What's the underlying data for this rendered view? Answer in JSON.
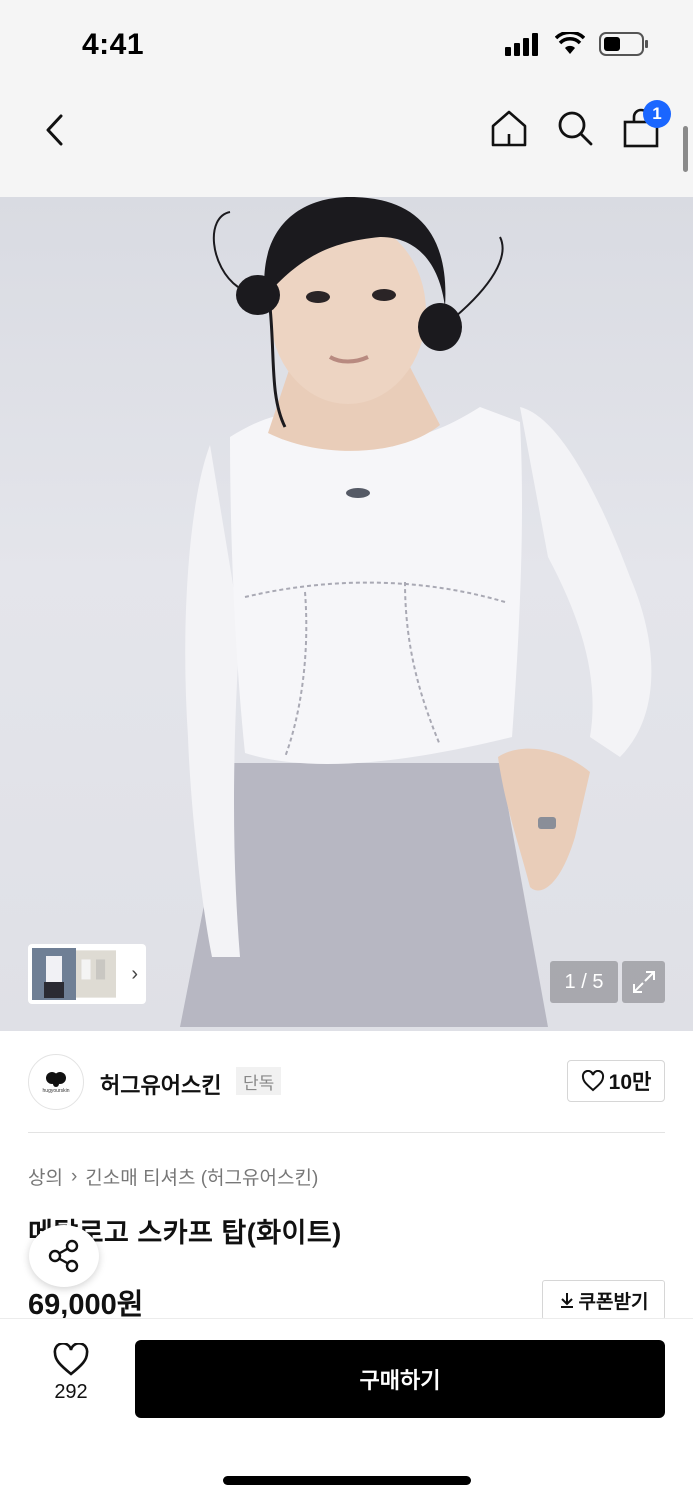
{
  "status_bar": {
    "time": "4:41"
  },
  "header": {
    "cart_count": "1"
  },
  "hero": {
    "pager": "1 / 5",
    "thumb_chevron": "›"
  },
  "brand": {
    "logo_text": "hugyourskin",
    "name": "허그유어스킨",
    "tag": "단독",
    "likes": "10만"
  },
  "product": {
    "breadcrumb": [
      "상의",
      "긴소매 티셔츠 (허그유어스킨)"
    ],
    "breadcrumb_sep": "›",
    "title": "메탈로고 스카프 탑(화이트)",
    "price": "69,000원",
    "coupon_label": "쿠폰받기"
  },
  "bottom_bar": {
    "wish_count": "292",
    "buy_label": "구매하기"
  },
  "colors": {
    "accent_badge": "#1a66ff",
    "buy_button": "#000000"
  }
}
